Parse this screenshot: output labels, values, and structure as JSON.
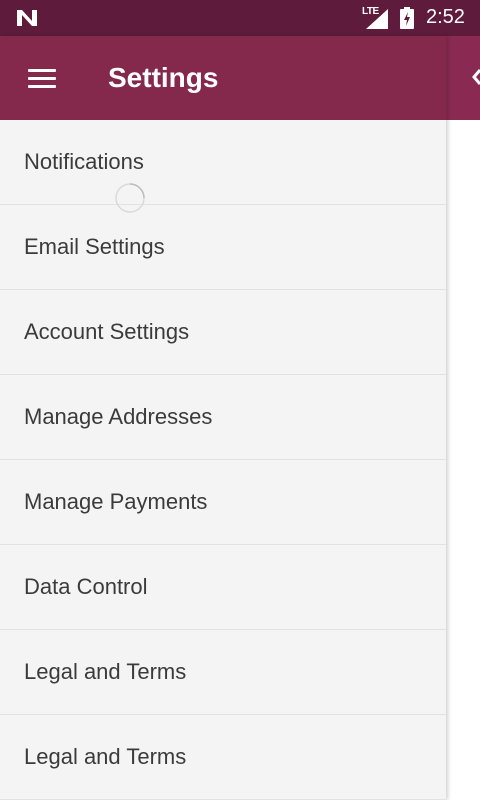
{
  "status_bar": {
    "network": "LTE",
    "time": "2:52",
    "icons": [
      "n-logo-icon",
      "signal-icon",
      "battery-charging-icon"
    ]
  },
  "drawer": {
    "title": "Settings",
    "menu_icon": "hamburger-menu-icon",
    "items": [
      {
        "label": "Notifications"
      },
      {
        "label": "Email Settings"
      },
      {
        "label": "Account Settings"
      },
      {
        "label": "Manage Addresses"
      },
      {
        "label": "Manage Payments"
      },
      {
        "label": "Data Control"
      },
      {
        "label": "Legal and Terms"
      },
      {
        "label": "Legal and Terms"
      }
    ]
  },
  "colors": {
    "status_bar": "#5e1b3b",
    "header": "#84284c",
    "drawer_bg": "#f4f4f4",
    "text": "#3b3b3b"
  }
}
